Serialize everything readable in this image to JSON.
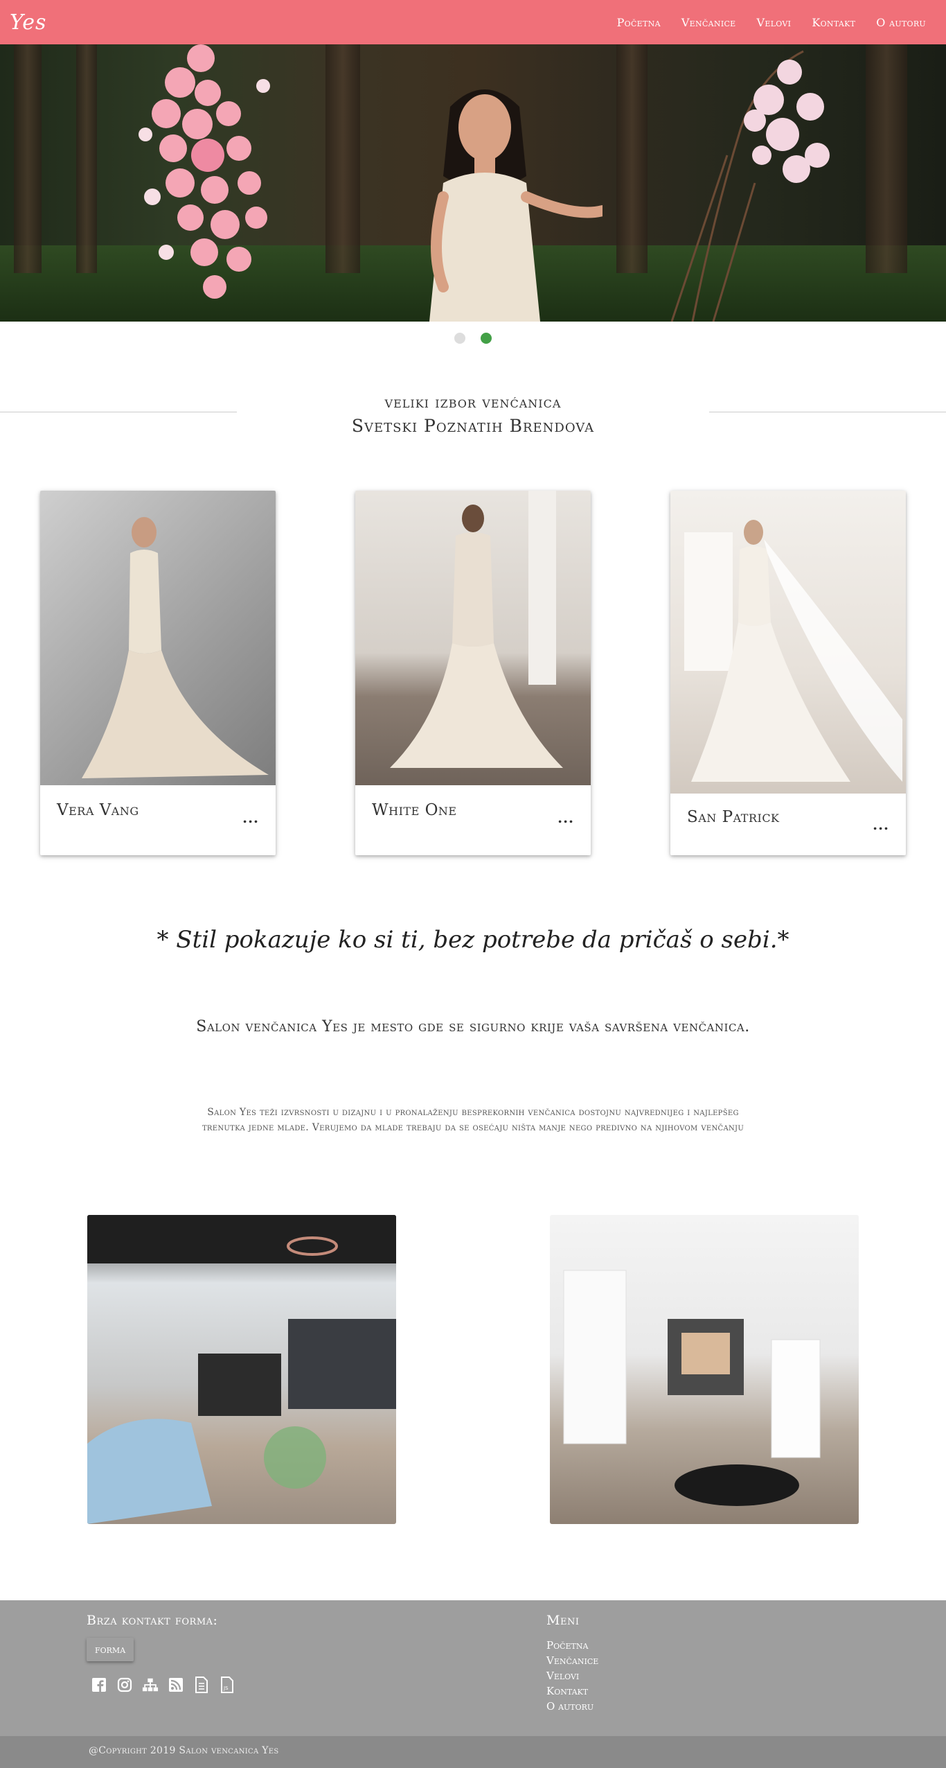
{
  "navbar": {
    "brand": "Yes",
    "links": [
      "Početna",
      "Venčanice",
      "Velovi",
      "Kontakt",
      "O autoru"
    ],
    "background": "#f07079"
  },
  "carousel": {
    "slides": 2,
    "active_index": 1,
    "active_color": "#43a047"
  },
  "heading": {
    "line1": "veliki izbor venćanica",
    "line2": "Svetski Poznatih Brendova"
  },
  "cards": [
    {
      "title": "Vera Vang",
      "more": "..."
    },
    {
      "title": "White One",
      "more": "..."
    },
    {
      "title": "San Patrick",
      "more": "..."
    }
  ],
  "quote": "* Stil pokazuje ko si ti, bez potrebe da pričaš o sebi.*",
  "lead": "Salon venčanica Yes je mesto gde se sigurno krije vaša savršena venčanica.",
  "paragraph": "Salon Yes teži izvrsnosti u dizajnu i u pronalaženju besprekornih venčanica dostojnu najvrednijeg i najlepšeg trenutka jedne mlade. Verujemo da mlade trebaju da se osećaju ništa manje nego predivno na njihovom venčanju",
  "footer": {
    "contact_title": "Brza kontakt forma:",
    "button_label": "forma",
    "social_icons": [
      "facebook-icon",
      "instagram-icon",
      "sitemap-icon",
      "rss-icon",
      "document-icon",
      "js-icon"
    ],
    "menu_title": "Meni",
    "menu": [
      "Početna",
      "Venčanice",
      "Velovi",
      "Kontakt",
      "O autoru"
    ],
    "copyright": "@Copyright 2019 Salon vencanica Yes"
  }
}
